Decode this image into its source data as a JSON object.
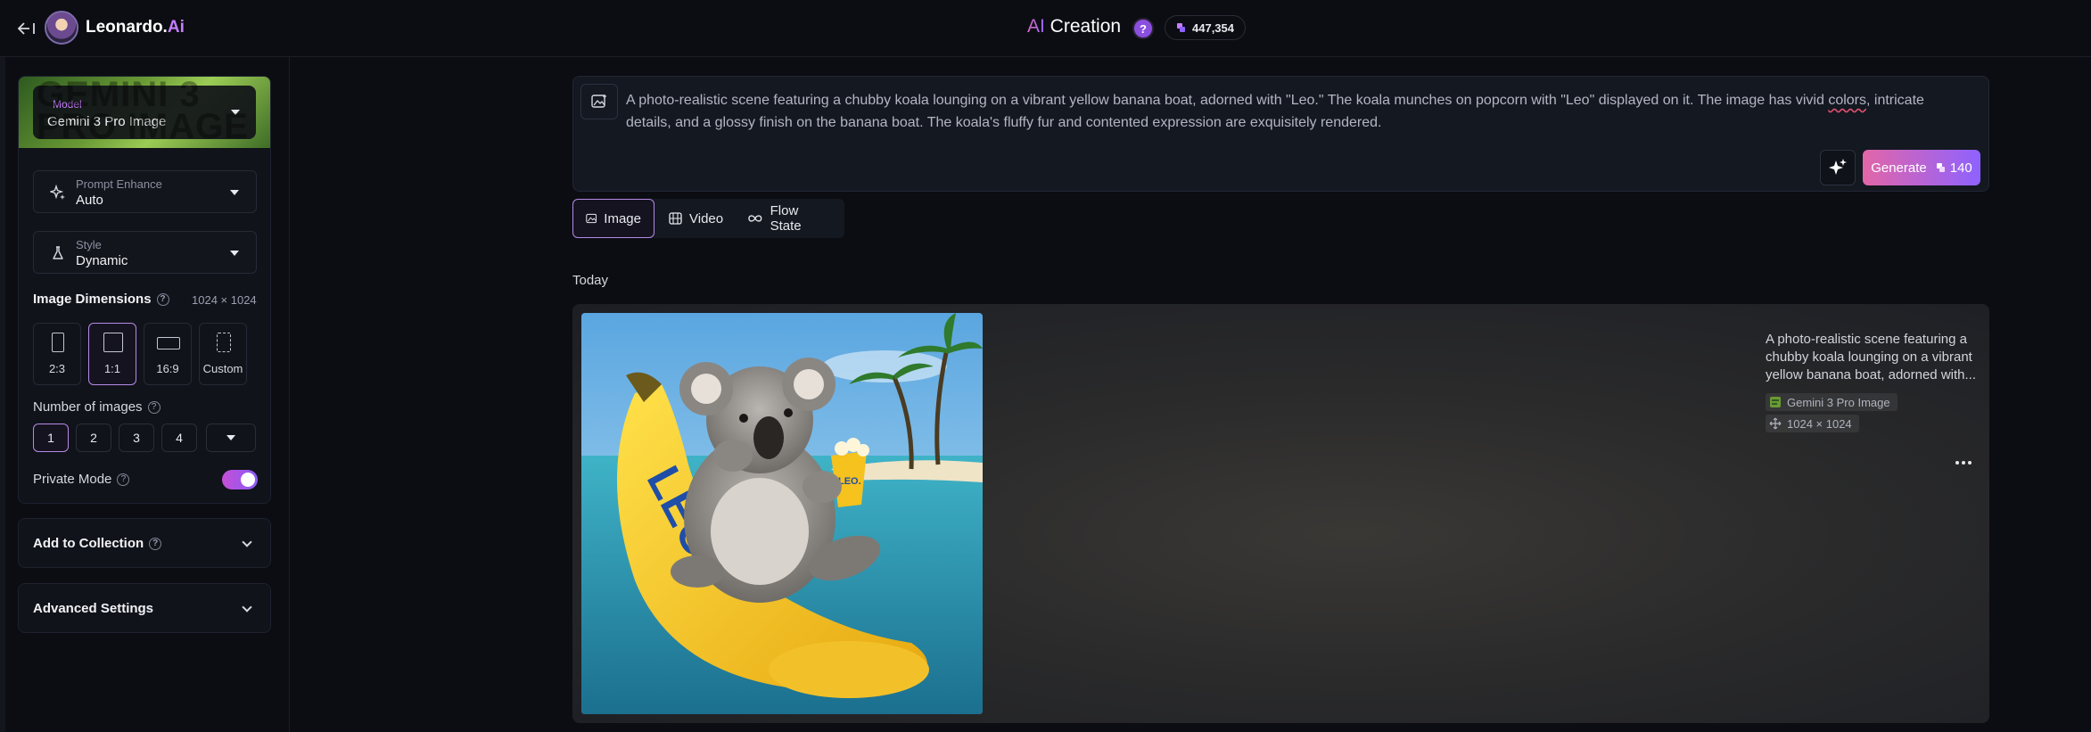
{
  "header": {
    "brand_name": "Leonardo.",
    "brand_suffix": "Ai",
    "title_ai": "AI",
    "title_rest": " Creation",
    "help_label": "?",
    "token_count": "447,354"
  },
  "sidebar": {
    "model_label": "Model",
    "model_value": "Gemini 3 Pro Image",
    "prompt_enhance_label": "Prompt Enhance",
    "prompt_enhance_value": "Auto",
    "style_label": "Style",
    "style_value": "Dynamic",
    "image_dimensions_label": "Image Dimensions",
    "image_dimensions_value": "1024 × 1024",
    "dimension_options": [
      {
        "label": "2:3",
        "selected": false
      },
      {
        "label": "1:1",
        "selected": true
      },
      {
        "label": "16:9",
        "selected": false
      },
      {
        "label": "Custom",
        "selected": false
      }
    ],
    "number_of_images_label": "Number of images",
    "number_options": [
      {
        "label": "1",
        "selected": true
      },
      {
        "label": "2",
        "selected": false
      },
      {
        "label": "3",
        "selected": false
      },
      {
        "label": "4",
        "selected": false
      }
    ],
    "private_mode_label": "Private Mode",
    "private_mode_on": true,
    "add_to_collection_label": "Add to Collection",
    "advanced_settings_label": "Advanced Settings"
  },
  "prompt": {
    "text_before": "A photo-realistic scene featuring a chubby koala lounging on a vibrant yellow banana boat, adorned with \"Leo.\" The koala munches on popcorn with \"Leo\" displayed on it. The image has vivid ",
    "text_underlined": "colors",
    "text_after": ", intricate details, and a glossy finish on the banana boat. The koala's fluffy fur and contented expression are exquisitely rendered.",
    "generate_label": "Generate",
    "generate_cost": "140"
  },
  "tabs": [
    {
      "label": "Image",
      "active": true
    },
    {
      "label": "Video",
      "active": false
    },
    {
      "label": "Flow State",
      "active": false
    }
  ],
  "feed": {
    "date_label": "Today",
    "card_description": "A photo-realistic scene featuring a chubby koala lounging on a vibrant yellow banana boat, adorned with...",
    "card_model": "Gemini 3 Pro Image",
    "card_dimensions": "1024 × 1024",
    "boat_text": "LEO.",
    "popcorn_text": "LEO."
  },
  "colors": {
    "accent_purple": "#c77dff",
    "generate_gradient_start": "#e266a8",
    "generate_gradient_end": "#8e62ff",
    "background": "#0b0d12"
  },
  "icons": {
    "back": "arrow-left-bar-icon",
    "prompt_enhance": "sparkles-icon",
    "style": "flask-icon",
    "image_tab": "image-icon",
    "video_tab": "film-icon",
    "flow_tab": "infinity-icon",
    "token": "token-stack-icon"
  }
}
